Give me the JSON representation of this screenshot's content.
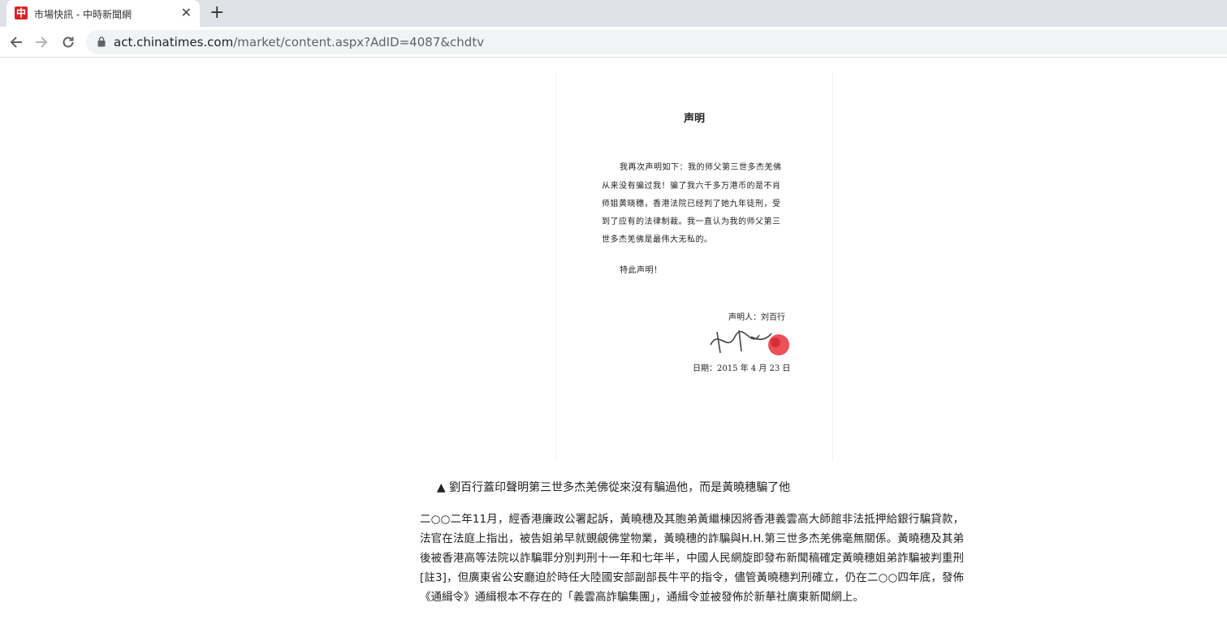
{
  "browser": {
    "tab_title": "市場快訊 - 中時新聞網",
    "favicon_text": "中",
    "url_host": "act.chinatimes.com",
    "url_path": "/market/content.aspx?AdID=4087&chdtv",
    "icons": {
      "back": "arrow-left-icon",
      "forward": "arrow-right-icon",
      "reload": "reload-icon",
      "lock": "lock-icon",
      "close": "close-icon",
      "new_tab": "plus-icon"
    },
    "brand_color": "#d7242a"
  },
  "document_image": {
    "title": "声明",
    "lines": [
      "我再次声明如下：我的师父第三世多杰羌佛",
      "从来没有骗过我！骗了我六千多万港币的是不肖",
      "师姐黄晓穗，香港法院已经判了她九年徒刑，受",
      "到了应有的法律制裁。我一直认为我的师父第三",
      "世多杰羌佛是最伟大无私的。",
      "特此声明！"
    ],
    "signature_label": "声明人：刘百行",
    "signature": "劉百行",
    "date": "日期：2015 年 4 月 23 日"
  },
  "caption": "▲ 劉百行蓋印聲明第三世多杰羌佛從來沒有騙過他，而是黃曉穗騙了他",
  "article": {
    "paragraph": "二○○二年11月，經香港廉政公署起訴，黃曉穗及其胞弟黃繼棟因將香港義雲高大師館非法抵押給銀行騙貸款，法官在法庭上指出，被告姐弟早就覬覦佛堂物業，黃曉穗的詐騙與H.H.第三世多杰羌佛毫無關係。黃曉穗及其弟後被香港高等法院以詐騙罪分別判刑十一年和七年半，中國人民網旋即發布新聞稿確定黃曉穗姐弟詐騙被判重刑[註3]，但廣東省公安廳迫於時任大陸國安部副部長牛平的指令，儘管黃曉穗判刑確立，仍在二○○四年底，發佈《通緝令》通緝根本不存在的「義雲高詐騙集團」，通緝令並被發佈於新華社廣東新聞網上。"
  }
}
